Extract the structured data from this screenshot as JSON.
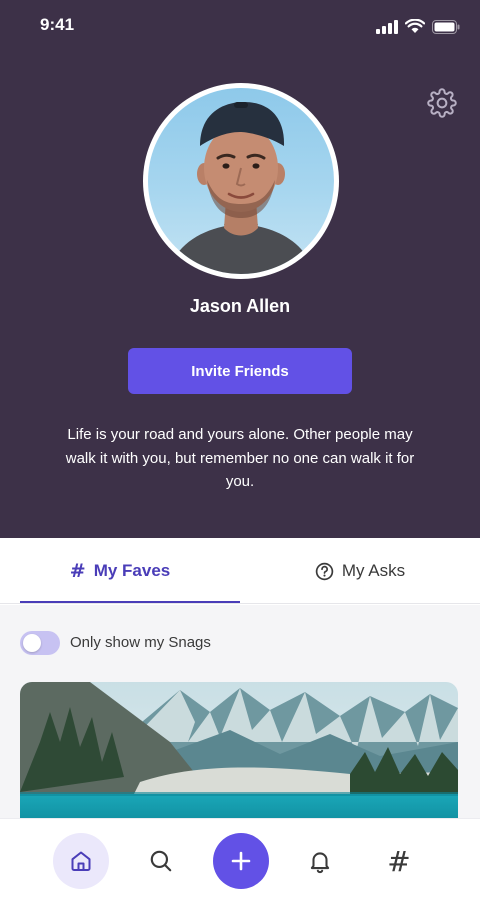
{
  "status_bar": {
    "time": "9:41"
  },
  "profile": {
    "name": "Jason Allen",
    "invite_label": "Invite Friends",
    "bio": "Life is your road and yours alone. Other people may walk it with you, but remember no one can walk it for you."
  },
  "tabs": [
    {
      "label": "My Faves",
      "icon": "hashtag-icon",
      "active": true
    },
    {
      "label": "My Asks",
      "icon": "question-circle-icon",
      "active": false
    }
  ],
  "filter": {
    "label": "Only show my Snags",
    "enabled": false
  },
  "bottom_nav": [
    {
      "icon": "home-icon",
      "active": true
    },
    {
      "icon": "search-icon",
      "active": false
    },
    {
      "icon": "plus-icon",
      "active": false
    },
    {
      "icon": "bell-icon",
      "active": false
    },
    {
      "icon": "hashtag-icon",
      "active": false
    }
  ],
  "colors": {
    "header_bg": "#3d3148",
    "accent": "#6251e6",
    "tab_active": "#4a3db8",
    "content_bg": "#f5f5f7"
  }
}
